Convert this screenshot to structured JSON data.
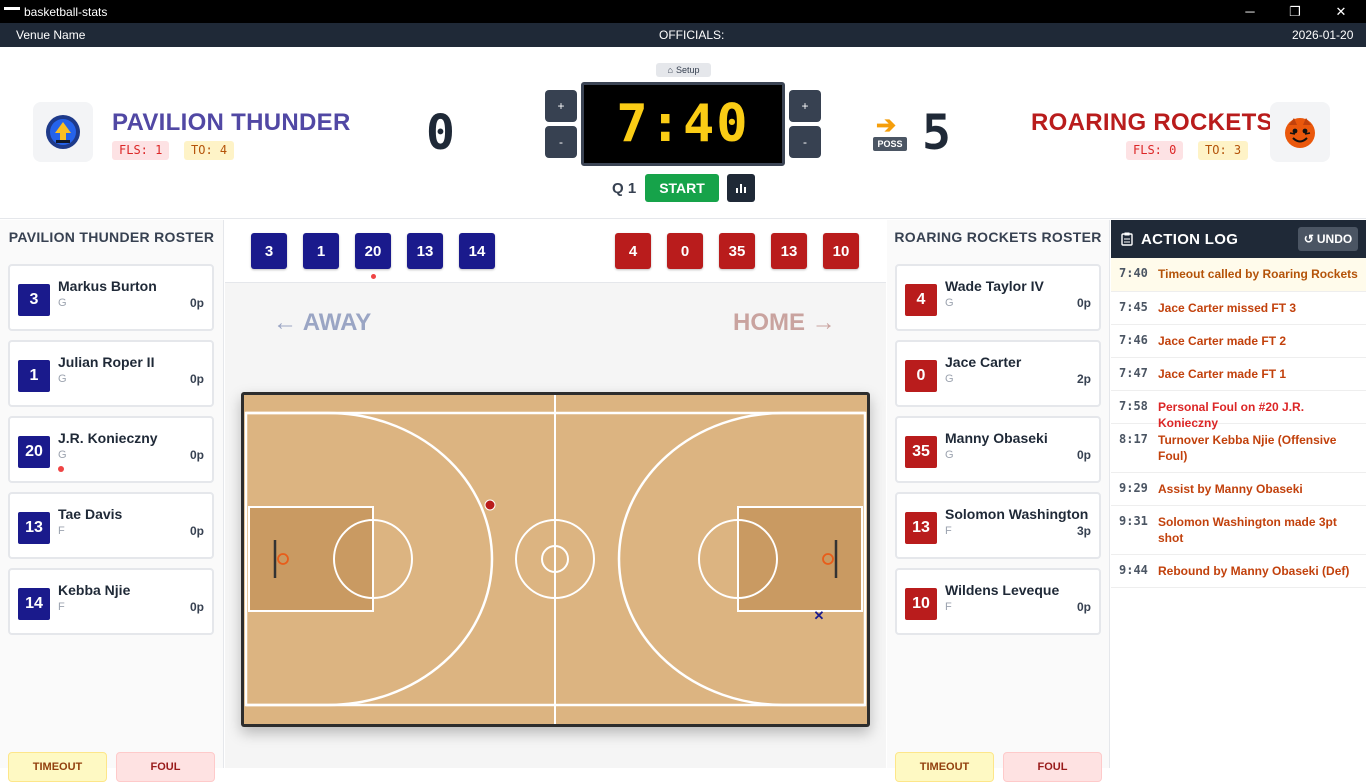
{
  "window": {
    "title": "basketball-stats",
    "minimize": "─",
    "maximize": "❐",
    "close": "✕"
  },
  "infobar": {
    "venue": "Venue Name",
    "officials": "OFFICIALS:",
    "date": "2026-01-20"
  },
  "colors": {
    "away": "#1a1a8c",
    "home": "#b91c1c",
    "away_text": "#5148a4",
    "home_text": "#b91c1c"
  },
  "away": {
    "name": "PAVILION THUNDER",
    "fouls": "FLS: 1",
    "timeouts": "TO: 4",
    "score": "0",
    "logo": "thunder-shield-logo",
    "roster_title": "PAVILION THUNDER ROSTER",
    "players": [
      {
        "number": "3",
        "name": "Markus Burton",
        "pos": "G",
        "pts": "0p"
      },
      {
        "number": "1",
        "name": "Julian Roper II",
        "pos": "G",
        "pts": "0p"
      },
      {
        "number": "20",
        "name": "J.R. Konieczny",
        "pos": "G",
        "pts": "0p"
      },
      {
        "number": "13",
        "name": "Tae Davis",
        "pos": "F",
        "pts": "0p"
      },
      {
        "number": "14",
        "name": "Kebba Njie",
        "pos": "F",
        "pts": "0p"
      }
    ],
    "timeout_label": "TIMEOUT",
    "foul_label": "FOUL"
  },
  "home": {
    "name": "ROARING ROCKETS",
    "fouls": "FLS: 0",
    "timeouts": "TO: 3",
    "score": "5",
    "logo": "rocket-tiger-logo",
    "roster_title": "ROARING ROCKETS ROSTER",
    "players": [
      {
        "number": "4",
        "name": "Wade Taylor IV",
        "pos": "G",
        "pts": "0p"
      },
      {
        "number": "0",
        "name": "Jace Carter",
        "pos": "G",
        "pts": "2p"
      },
      {
        "number": "35",
        "name": "Manny Obaseki",
        "pos": "G",
        "pts": "0p"
      },
      {
        "number": "13",
        "name": "Solomon Washington",
        "pos": "F",
        "pts": "3p"
      },
      {
        "number": "10",
        "name": "Wildens Leveque",
        "pos": "F",
        "pts": "0p"
      }
    ],
    "timeout_label": "TIMEOUT",
    "foul_label": "FOUL"
  },
  "clock": {
    "time": "7:40",
    "quarter": "Q 1",
    "start": "START",
    "setup": "Setup",
    "plus": "+",
    "minus": "-",
    "possession": "POSS",
    "possession_arrow": "➔"
  },
  "lineup": {
    "away": [
      "3",
      "1",
      "20",
      "13",
      "14"
    ],
    "home": [
      "4",
      "0",
      "35",
      "13",
      "10"
    ]
  },
  "court": {
    "away_label": "AWAY",
    "home_label": "HOME",
    "left_arrow": "←",
    "right_arrow": "→",
    "marker_x": "✕"
  },
  "log": {
    "title": "ACTION LOG",
    "undo": "UNDO",
    "entries": [
      {
        "time": "7:40",
        "text": "Timeout called by Roaring Rockets",
        "color": "#b45309"
      },
      {
        "time": "7:45",
        "text": "Jace Carter missed FT 3",
        "color": "#c2410c"
      },
      {
        "time": "7:46",
        "text": "Jace Carter made FT 2",
        "color": "#c2410c"
      },
      {
        "time": "7:47",
        "text": "Jace Carter made FT 1",
        "color": "#c2410c"
      },
      {
        "time": "7:58",
        "text": "Personal Foul on #20 J.R. Konieczny",
        "color": "#dc2626"
      },
      {
        "time": "8:17",
        "text": "Turnover Kebba Njie (Offensive Foul)",
        "color": "#c2410c"
      },
      {
        "time": "9:29",
        "text": "Assist by Manny Obaseki",
        "color": "#c2410c"
      },
      {
        "time": "9:31",
        "text": "Solomon Washington made 3pt shot",
        "color": "#c2410c"
      },
      {
        "time": "9:44",
        "text": "Rebound by Manny Obaseki (Def)",
        "color": "#c2410c"
      }
    ]
  }
}
